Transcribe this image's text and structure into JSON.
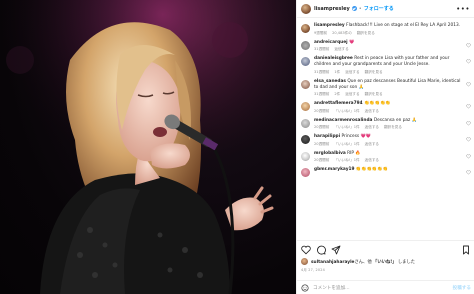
{
  "post": {
    "username": "lisampresley",
    "dot": "•",
    "follow_label": "フォローする",
    "more_label": "•••"
  },
  "caption": {
    "username": "lisampresley",
    "text": "Flashback!!! Live on stage at el El Rey LA April 2013.",
    "meta_time": "9週間前",
    "meta_likes": "20,483件の",
    "meta_reply": "翻訳を見る"
  },
  "comments": [
    {
      "user": "andreicarquej",
      "text": "💗",
      "time": "31週間前",
      "likes": "",
      "reply": "返信する"
    },
    {
      "user": "daniealeisgbree",
      "text": "Rest in peace Lisa with your father and your children and your grandparents and your Uncle Jesse.",
      "time": "31週間前",
      "likes": "1件",
      "reply": "返信する",
      "translate": "翻訳を見る"
    },
    {
      "user": "elsa_sanedas",
      "text": "Que en paz descanses Beautiful Lisa Marie, identical to dad and your son 🙏",
      "time": "31週間前",
      "likes": "2件",
      "reply": "返信する",
      "translate": "翻訳を見る"
    },
    {
      "user": "andrettaflemera794",
      "text": "👏👏👏👏👏",
      "time": "20週間前",
      "likes": "「いいね!」1件",
      "reply": "返信する"
    },
    {
      "user": "medinacarmenrosalinda",
      "text": "Descansa en paz 🙏",
      "time": "20週間前",
      "likes": "「いいね!」1件",
      "reply": "返信する",
      "translate": "翻訳を見る"
    },
    {
      "user": "harapilippi",
      "text": "Princess 💗💗",
      "time": "20週間前",
      "likes": "「いいね!」1件",
      "reply": "返信する"
    },
    {
      "user": "mrglobalbiva",
      "text": "RIP 🔥",
      "time": "20週間前",
      "likes": "「いいね!」1件",
      "reply": "返信する"
    },
    {
      "user": "gbmr.marykay19",
      "text": "👏👏👏👏👏👏",
      "time": "",
      "likes": "",
      "reply": ""
    }
  ],
  "actions": {
    "like_icon": "heart-icon",
    "comment_icon": "comment-icon",
    "share_icon": "paper-plane-icon",
    "save_icon": "bookmark-icon",
    "liked_by_user": "sultanahjaharayle",
    "liked_by_suffix": "さん、他",
    "liked_by_others": "「いいね!」",
    "liked_by_end": "しました",
    "date": "4月 27, 2024"
  },
  "add_comment": {
    "placeholder": "コメントを追加...",
    "post_label": "投稿する"
  },
  "colors": {
    "accent": "#0095f6",
    "verified": "#3897f0",
    "stage_light": "#c2378a"
  }
}
